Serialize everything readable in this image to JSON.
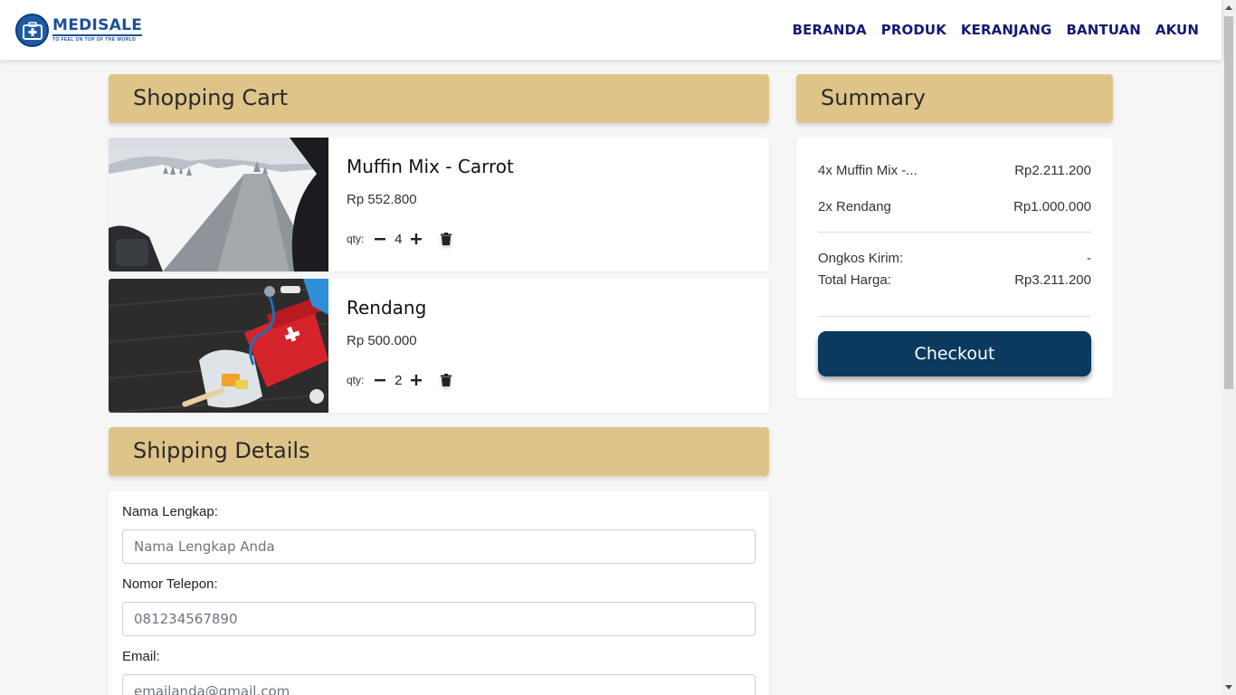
{
  "brand": {
    "name": "MEDISALE",
    "tagline": "TO FEEL ON TOP OF THE WORLD",
    "color": "#1c4f9c"
  },
  "nav": {
    "items": [
      "BERANDA",
      "PRODUK",
      "KERANJANG",
      "BANTUAN",
      "AKUN"
    ],
    "color": "#121a73"
  },
  "cart": {
    "title": "Shopping Cart",
    "qty_label": "qty:",
    "items": [
      {
        "name": "Muffin Mix - Carrot",
        "price": "Rp 552.800",
        "qty": "4",
        "image": "snowy-road-photo"
      },
      {
        "name": "Rendang",
        "price": "Rp 500.000",
        "qty": "2",
        "image": "first-aid-kit-photo"
      }
    ]
  },
  "summary": {
    "title": "Summary",
    "lines": [
      {
        "label": "4x Muffin Mix -...",
        "amount": "Rp2.211.200"
      },
      {
        "label": "2x Rendang",
        "amount": "Rp1.000.000"
      }
    ],
    "shipping_label": "Ongkos Kirim:",
    "shipping_value": "-",
    "total_label": "Total Harga:",
    "total_value": "Rp3.211.200",
    "checkout_label": "Checkout",
    "checkout_color": "#0c3a5e"
  },
  "shipping": {
    "title": "Shipping Details",
    "fields": [
      {
        "label": "Nama Lengkap:",
        "placeholder": "Nama Lengkap Anda",
        "value": ""
      },
      {
        "label": "Nomor Telepon:",
        "placeholder": "081234567890",
        "value": ""
      },
      {
        "label": "Email:",
        "placeholder": "emailanda@gmail.com",
        "value": ""
      }
    ]
  },
  "colors": {
    "section_header": "#dfc48a",
    "page_bg": "#f6f6f7"
  },
  "icons": [
    "medical-kit-logo-icon",
    "minus-icon",
    "plus-icon",
    "trash-icon"
  ]
}
